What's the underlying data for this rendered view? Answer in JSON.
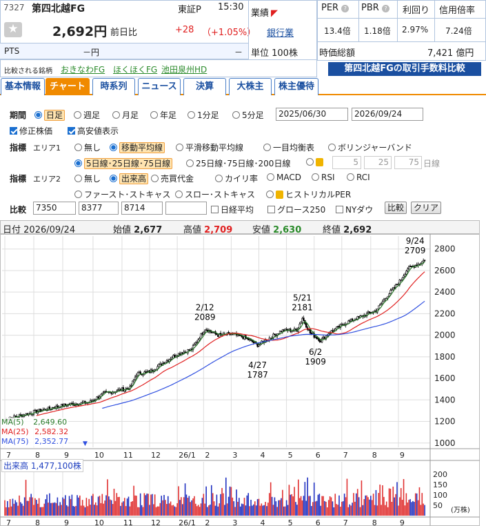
{
  "stock": {
    "code": "7327",
    "name": "第四北越FG",
    "market": "東証P",
    "time": "15:30",
    "price": "2,692円",
    "prev_label": "前日比",
    "change": "+28",
    "change_pct": "（+1.05%）",
    "sector_label": "業績",
    "sector_link": "銀行業",
    "pts_label": "PTS",
    "pts_value": "－円",
    "pts_change": "－",
    "unit": "単位 100株",
    "compare_label": "比較される銘柄",
    "compare_links": [
      "おきなわFG",
      "ほくほくFG",
      "池田泉州HD"
    ],
    "fee_banner": "第四北越FGの取引手数料比較"
  },
  "metrics": {
    "headers": [
      "PER",
      "PBR",
      "利回り",
      "信用倍率"
    ],
    "values": [
      "13.4倍",
      "1.18倍",
      "2.97%",
      "7.24倍"
    ],
    "mcap_label": "時価総額",
    "mcap_value": "7,421 億円"
  },
  "tabs": [
    "基本情報",
    "チャート",
    "時系列",
    "ニュース",
    "決算",
    "大株主",
    "株主優待"
  ],
  "controls": {
    "period_label": "期間",
    "periods": [
      "日足",
      "週足",
      "月足",
      "年足",
      "1分足",
      "5分足"
    ],
    "date_from": "2025/06/30",
    "date_to": "2026/09/24",
    "adjusted": "修正株価",
    "highlow": "高安値表示",
    "indicator_label": "指標",
    "area1": "エリア1",
    "area1_opts": [
      "無し",
      "移動平均線",
      "平滑移動平均線",
      "一目均衡表",
      "ボリンジャーバンド"
    ],
    "ma_opts": [
      "5日線･25日線･75日線",
      "25日線･75日線･200日線"
    ],
    "ma_inputs": [
      "5",
      "25",
      "75"
    ],
    "ma_unit": "日線",
    "area2": "エリア2",
    "area2_opts": [
      "無し",
      "出来高",
      "売買代金",
      "カイリ率",
      "MACD",
      "RSI",
      "RCI",
      "ファースト･ストキャス",
      "スロー･ストキャス",
      "ヒストリカルPER"
    ],
    "compare_label": "比較",
    "compare_codes": [
      "7350",
      "8377",
      "8714",
      ""
    ],
    "idx_opts": [
      "日経平均",
      "グロース250",
      "NYダウ"
    ],
    "btn_compare": "比較",
    "btn_clear": "クリア"
  },
  "ohlc": {
    "date_label": "日付",
    "date": "2026/09/24",
    "open_label": "始値",
    "open": "2,677",
    "high_label": "高値",
    "high": "2,709",
    "low_label": "安値",
    "low": "2,630",
    "close_label": "終値",
    "close": "2,692"
  },
  "ma_legend": [
    {
      "label": "MA(5)",
      "value": "2,649.60",
      "color": "#2a7a2a"
    },
    {
      "label": "MA(25)",
      "value": "2,582.32",
      "color": "#e02020"
    },
    {
      "label": "MA(75)",
      "value": "2,352.77",
      "color": "#3050e0"
    }
  ],
  "volume_label": "出来高",
  "volume_value": "1,477,100株",
  "volume_unit": "(万株)",
  "chart_data": {
    "type": "line",
    "yticks": [
      2800,
      2600,
      2400,
      2200,
      2000,
      1800,
      1600,
      1400,
      1200,
      1000
    ],
    "ylim": [
      960,
      2920
    ],
    "vol_ticks": [
      200,
      150,
      100,
      50
    ],
    "months": [
      "7",
      "8",
      "9",
      "10",
      "11",
      "12",
      "26/1",
      "2",
      "3",
      "4",
      "5",
      "6",
      "7",
      "8",
      "9"
    ],
    "annotations": [
      {
        "date": "2/12",
        "value": "2089"
      },
      {
        "date": "4/27",
        "value": "1787"
      },
      {
        "date": "5/21",
        "value": "2181"
      },
      {
        "date": "6/2",
        "value": "1909"
      },
      {
        "date": "9/24",
        "value": "2709"
      }
    ],
    "price_anchors": [
      [
        0,
        1220
      ],
      [
        20,
        1280
      ],
      [
        45,
        1350
      ],
      [
        65,
        1380
      ],
      [
        75,
        1460
      ],
      [
        95,
        1510
      ],
      [
        100,
        1640
      ],
      [
        110,
        1660
      ],
      [
        130,
        1820
      ],
      [
        142,
        1870
      ],
      [
        152,
        2060
      ],
      [
        162,
        2000
      ],
      [
        172,
        2010
      ],
      [
        182,
        1980
      ],
      [
        192,
        1910
      ],
      [
        198,
        1950
      ],
      [
        210,
        2040
      ],
      [
        222,
        2050
      ],
      [
        226,
        2160
      ],
      [
        232,
        2020
      ],
      [
        240,
        1950
      ],
      [
        246,
        2020
      ],
      [
        260,
        2120
      ],
      [
        272,
        2180
      ],
      [
        282,
        2230
      ],
      [
        290,
        2360
      ],
      [
        300,
        2500
      ],
      [
        306,
        2620
      ],
      [
        314,
        2660
      ],
      [
        318,
        2692
      ]
    ]
  }
}
